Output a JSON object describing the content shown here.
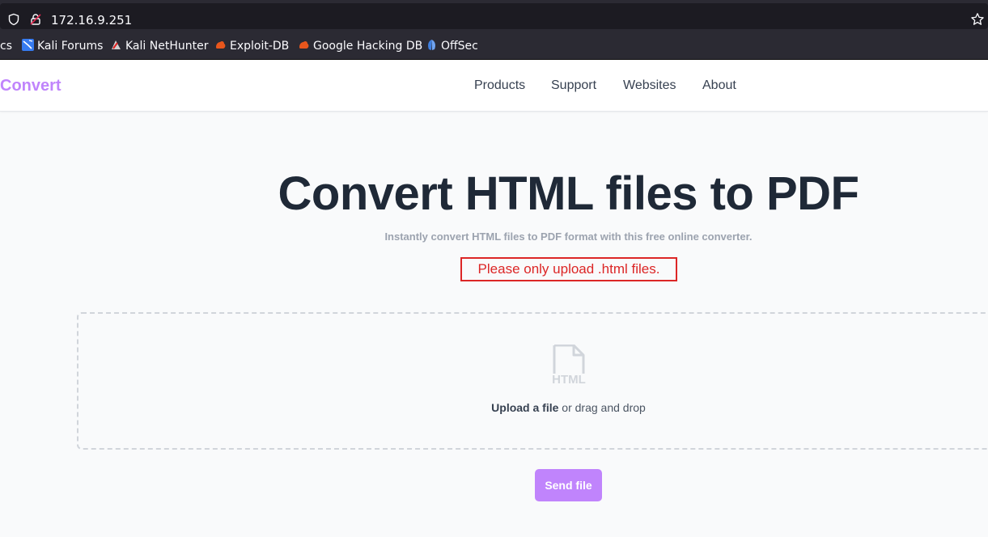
{
  "browser": {
    "url": "172.16.9.251",
    "bookmarks": [
      {
        "label": "cs",
        "icon": "kali-docs-icon"
      },
      {
        "label": "Kali Forums",
        "icon": "kali-forums-icon"
      },
      {
        "label": "Kali NetHunter",
        "icon": "kali-nethunter-icon"
      },
      {
        "label": "Exploit-DB",
        "icon": "exploit-db-icon"
      },
      {
        "label": "Google Hacking DB",
        "icon": "ghdb-icon"
      },
      {
        "label": "OffSec",
        "icon": "offsec-icon"
      }
    ]
  },
  "site": {
    "logo": "Convert",
    "nav": [
      "Products",
      "Support",
      "Websites",
      "About"
    ]
  },
  "main": {
    "title": "Convert HTML files to PDF",
    "subtitle": "Instantly convert HTML files to PDF format with this free online converter.",
    "alert": "Please only upload .html files.",
    "dropzone": {
      "file_icon_label": "HTML",
      "upload_link": "Upload a file",
      "upload_suffix": " or drag and drop"
    },
    "send_button": "Send file"
  },
  "colors": {
    "accent": "#c084fc",
    "alert": "#dc2626",
    "heading": "#1f2937"
  }
}
